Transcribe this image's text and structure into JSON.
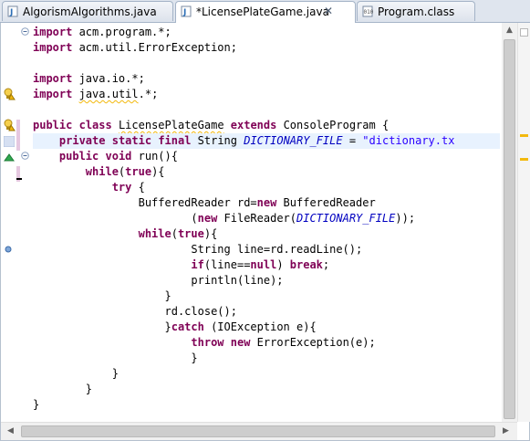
{
  "tabs": [
    {
      "label": "AlgorismAlgorithms.java",
      "icon": "java-file-icon",
      "active": false
    },
    {
      "label": "*LicensePlateGame.java",
      "icon": "java-file-icon",
      "active": true,
      "close": "✕"
    },
    {
      "label": "Program.class",
      "icon": "class-file-icon",
      "active": false
    }
  ],
  "editor": {
    "lines": [
      [
        "import acm.program.*;"
      ],
      [
        "import acm.util.ErrorException;"
      ],
      [
        ""
      ],
      [
        "import java.io.*;"
      ],
      [
        "import java.util.*;"
      ],
      [
        ""
      ],
      [
        "public class LicensePlateGame extends ConsoleProgram {"
      ],
      [
        "    private static final String DICTIONARY_FILE = \"dictionary.tx"
      ],
      [
        "    public void run(){"
      ],
      [
        "        while(true){"
      ],
      [
        "            try {"
      ],
      [
        "                BufferedReader rd=new BufferedReader"
      ],
      [
        "                        (new FileReader(DICTIONARY_FILE));"
      ],
      [
        "                while(true){"
      ],
      [
        "                        String line=rd.readLine();"
      ],
      [
        "                        if(line==null) break;"
      ],
      [
        "                        println(line);"
      ],
      [
        "                    }"
      ],
      [
        "                    rd.close();"
      ],
      [
        "                    }catch (IOException e){"
      ],
      [
        "                        throw new ErrorException(e);"
      ],
      [
        "                        }"
      ],
      [
        "            }"
      ],
      [
        "        }"
      ],
      [
        "}"
      ]
    ]
  },
  "colors": {
    "keyword": "#7f0055",
    "string": "#2a00ff",
    "constant": "#0000c0",
    "current_line": "#e8f2fe",
    "warning_underline": "#f3b90d"
  },
  "markers": {
    "warning": "warning-bulb-icon",
    "fold": "fold-minus-icon",
    "override": "override-triangle-icon",
    "breakpoint": "breakpoint-icon"
  }
}
